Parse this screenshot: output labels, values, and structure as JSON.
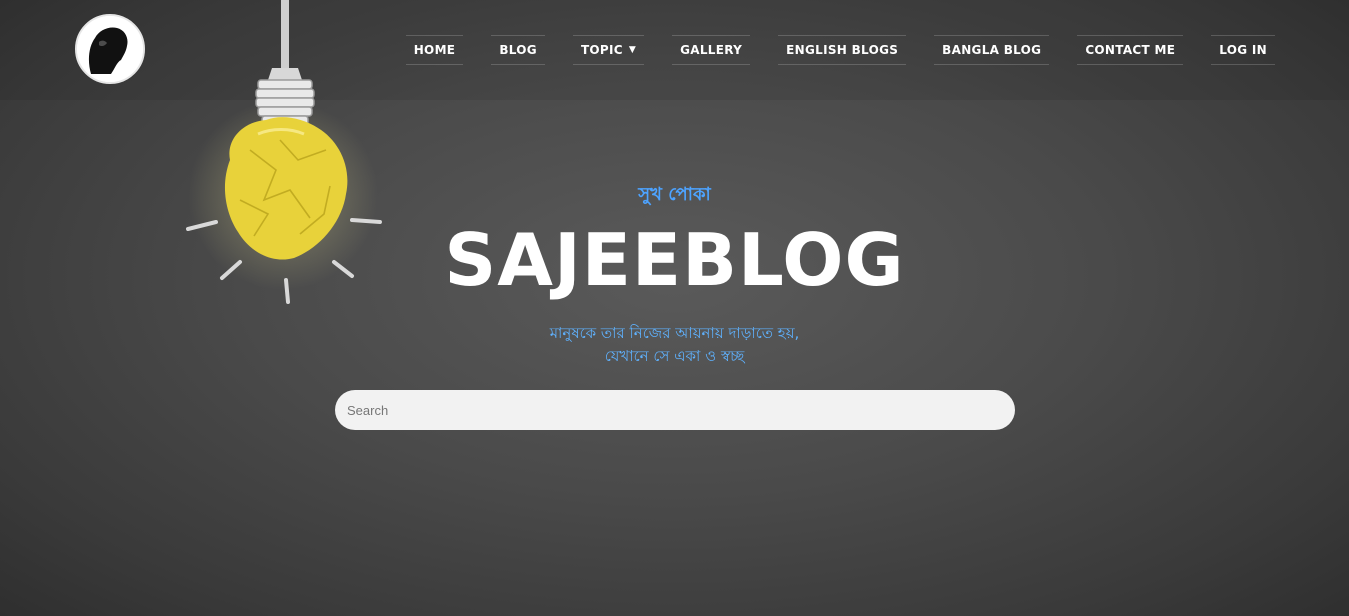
{
  "nav": {
    "items": [
      {
        "label": "HOME"
      },
      {
        "label": "BLOG"
      },
      {
        "label": "TOPIC",
        "has_dropdown": true
      },
      {
        "label": "GALLERY"
      },
      {
        "label": "ENGLISH BLOGS"
      },
      {
        "label": "BANGLA BLOG"
      },
      {
        "label": "CONTACT ME"
      },
      {
        "label": "LOG IN"
      }
    ],
    "dropdown_icon": "chevron-down-icon"
  },
  "hero": {
    "tagline": "সুখ পোকা",
    "title": "SAJEEBLOG",
    "subtitle_line1": "মানুষকে তার নিজের আয়নায় দাড়াতে হয়,",
    "subtitle_line2": "যেখানে সে একা ও স্বচ্ছ"
  },
  "search": {
    "placeholder": "Search",
    "value": ""
  },
  "colors": {
    "accent_blue": "#4da3ff",
    "subtitle_blue": "#5fb2ff",
    "bulb_yellow": "#e8d23a",
    "nav_text": "#ffffff"
  }
}
